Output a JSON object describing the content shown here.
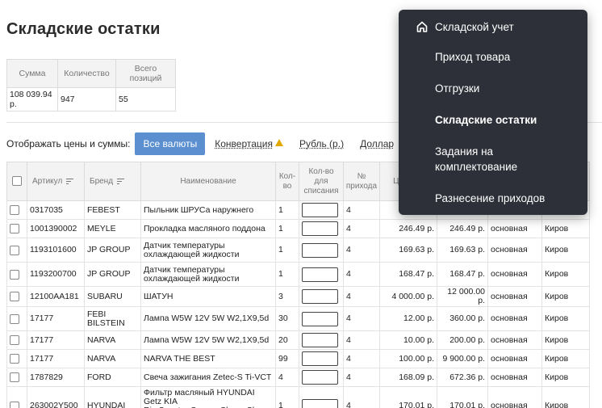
{
  "page": {
    "title": "Складские остатки"
  },
  "summary": {
    "headers": [
      "Сумма",
      "Количество",
      "Всего позиций"
    ],
    "values": [
      "108 039.94 р.",
      "947",
      "55"
    ]
  },
  "currency": {
    "label": "Отображать цены и суммы:",
    "active": "Все валюты",
    "links": [
      "Конвертация",
      "Рубль (р.)",
      "Доллар"
    ]
  },
  "grid": {
    "headers": {
      "article": "Артикул",
      "brand": "Бренд",
      "name": "Наименование",
      "qty": "Кол-во",
      "writeoff": "Кол-во для списания",
      "receipt": "№ прихода",
      "price": "Ц... пр...",
      "sum": "",
      "warehouse": "",
      "city": ""
    },
    "rows": [
      {
        "article": "0317035",
        "brand": "FEBEST",
        "name": "Пыльник ШРУСа наружнего",
        "qty": "1",
        "receipt": "4",
        "price": "",
        "sum": "",
        "warehouse": "",
        "city": ""
      },
      {
        "article": "1001390002",
        "brand": "MEYLE",
        "name": "Прокладка масляного поддона",
        "qty": "1",
        "receipt": "4",
        "price": "246.49 р.",
        "sum": "246.49 р.",
        "warehouse": "основная",
        "city": "Киров"
      },
      {
        "article": "1193101600",
        "brand": "JP GROUP",
        "name": "Датчик температуры охлаждающей жидкости",
        "qty": "1",
        "receipt": "4",
        "price": "169.63 р.",
        "sum": "169.63 р.",
        "warehouse": "основная",
        "city": "Киров"
      },
      {
        "article": "1193200700",
        "brand": "JP GROUP",
        "name": "Датчик температуры охлаждающей жидкости",
        "qty": "1",
        "receipt": "4",
        "price": "168.47 р.",
        "sum": "168.47 р.",
        "warehouse": "основная",
        "city": "Киров"
      },
      {
        "article": "12100AA181",
        "brand": "SUBARU",
        "name": "ШАТУН",
        "qty": "3",
        "receipt": "4",
        "price": "4 000.00 р.",
        "sum": "12 000.00 р.",
        "warehouse": "основная",
        "city": "Киров"
      },
      {
        "article": "17177",
        "brand": "FEBI BILSTEIN",
        "name": "Лампа W5W 12V 5W W2,1X9,5d",
        "qty": "30",
        "receipt": "4",
        "price": "12.00 р.",
        "sum": "360.00 р.",
        "warehouse": "основная",
        "city": "Киров"
      },
      {
        "article": "17177",
        "brand": "NARVA",
        "name": "Лампа W5W 12V 5W W2,1X9,5d",
        "qty": "20",
        "receipt": "4",
        "price": "10.00 р.",
        "sum": "200.00 р.",
        "warehouse": "основная",
        "city": "Киров"
      },
      {
        "article": "17177",
        "brand": "NARVA",
        "name": "NARVA THE BEST",
        "qty": "99",
        "receipt": "4",
        "price": "100.00 р.",
        "sum": "9 900.00 р.",
        "warehouse": "основная",
        "city": "Киров"
      },
      {
        "article": "1787829",
        "brand": "FORD",
        "name": "Свеча зажигания Zetec-S Ti-VCT",
        "qty": "4",
        "receipt": "4",
        "price": "168.09 р.",
        "sum": "672.36 р.",
        "warehouse": "основная",
        "city": "Киров"
      },
      {
        "article": "263002Y500",
        "brand": "HYUNDAI",
        "name": "Фильтр масляный HYUNDAI Getz KIA Rio,Spectra,Carens,Clarus,Shuma OE",
        "qty": "1",
        "receipt": "4",
        "price": "170.01 р.",
        "sum": "170.01 р.",
        "warehouse": "основная",
        "city": "Киров"
      }
    ]
  },
  "menu": {
    "home": "Складской учет",
    "items": [
      "Приход товара",
      "Отгрузки",
      "Складские остатки",
      "Задания на комплектование",
      "Разнесение приходов"
    ]
  },
  "colors": {
    "accent": "#5b8fd0",
    "menu_bg": "#2e3039",
    "warning": "#e0a800"
  }
}
